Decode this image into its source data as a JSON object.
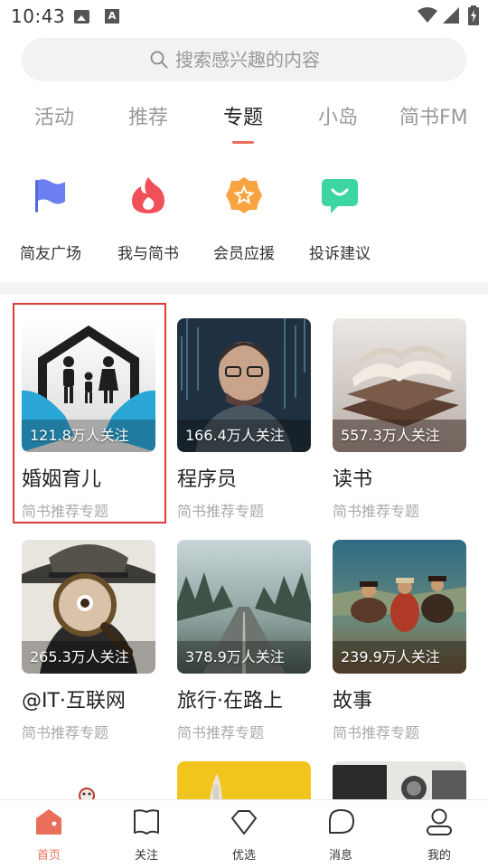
{
  "status_bar": {
    "time": "10:43",
    "icons": [
      "image-icon",
      "font-a-icon",
      "wifi-icon",
      "signal-icon",
      "battery-icon"
    ]
  },
  "search": {
    "placeholder": "搜索感兴趣的内容"
  },
  "tabs": [
    {
      "label": "活动",
      "active": false
    },
    {
      "label": "推荐",
      "active": false
    },
    {
      "label": "专题",
      "active": true
    },
    {
      "label": "小岛",
      "active": false
    },
    {
      "label": "简书FM",
      "active": false
    }
  ],
  "quick_actions": [
    {
      "label": "简友广场",
      "icon": "flag-icon",
      "color": "#6b7ff0"
    },
    {
      "label": "我与简书",
      "icon": "flame-icon",
      "color": "#f0505a"
    },
    {
      "label": "会员应援",
      "icon": "star-badge-icon",
      "color": "#f6a340"
    },
    {
      "label": "投诉建议",
      "icon": "feedback-chat-icon",
      "color": "#3ed6a0"
    }
  ],
  "topics": [
    {
      "title": "婚姻育儿",
      "followers": "121.8万人关注",
      "subtitle": "简书推荐专题",
      "image": "family-house-image"
    },
    {
      "title": "程序员",
      "followers": "166.4万人关注",
      "subtitle": "简书推荐专题",
      "image": "programmer-image"
    },
    {
      "title": "读书",
      "followers": "557.3万人关注",
      "subtitle": "简书推荐专题",
      "image": "books-image"
    },
    {
      "title": "@IT·互联网",
      "followers": "265.3万人关注",
      "subtitle": "简书推荐专题",
      "image": "magnifier-detective-image"
    },
    {
      "title": "旅行·在路上",
      "followers": "378.9万人关注",
      "subtitle": "简书推荐专题",
      "image": "forest-road-image"
    },
    {
      "title": "故事",
      "followers": "239.9万人关注",
      "subtitle": "简书推荐专题",
      "image": "western-painting-image"
    }
  ],
  "bottom_nav": [
    {
      "label": "首页",
      "icon": "home-icon",
      "active": true
    },
    {
      "label": "关注",
      "icon": "bookmark-icon",
      "active": false
    },
    {
      "label": "优选",
      "icon": "diamond-icon",
      "active": false
    },
    {
      "label": "消息",
      "icon": "message-bubble-icon",
      "active": false
    },
    {
      "label": "我的",
      "icon": "user-icon",
      "active": false
    }
  ],
  "colors": {
    "accent": "#ea6f5a",
    "highlight_border": "#e03a3a"
  }
}
